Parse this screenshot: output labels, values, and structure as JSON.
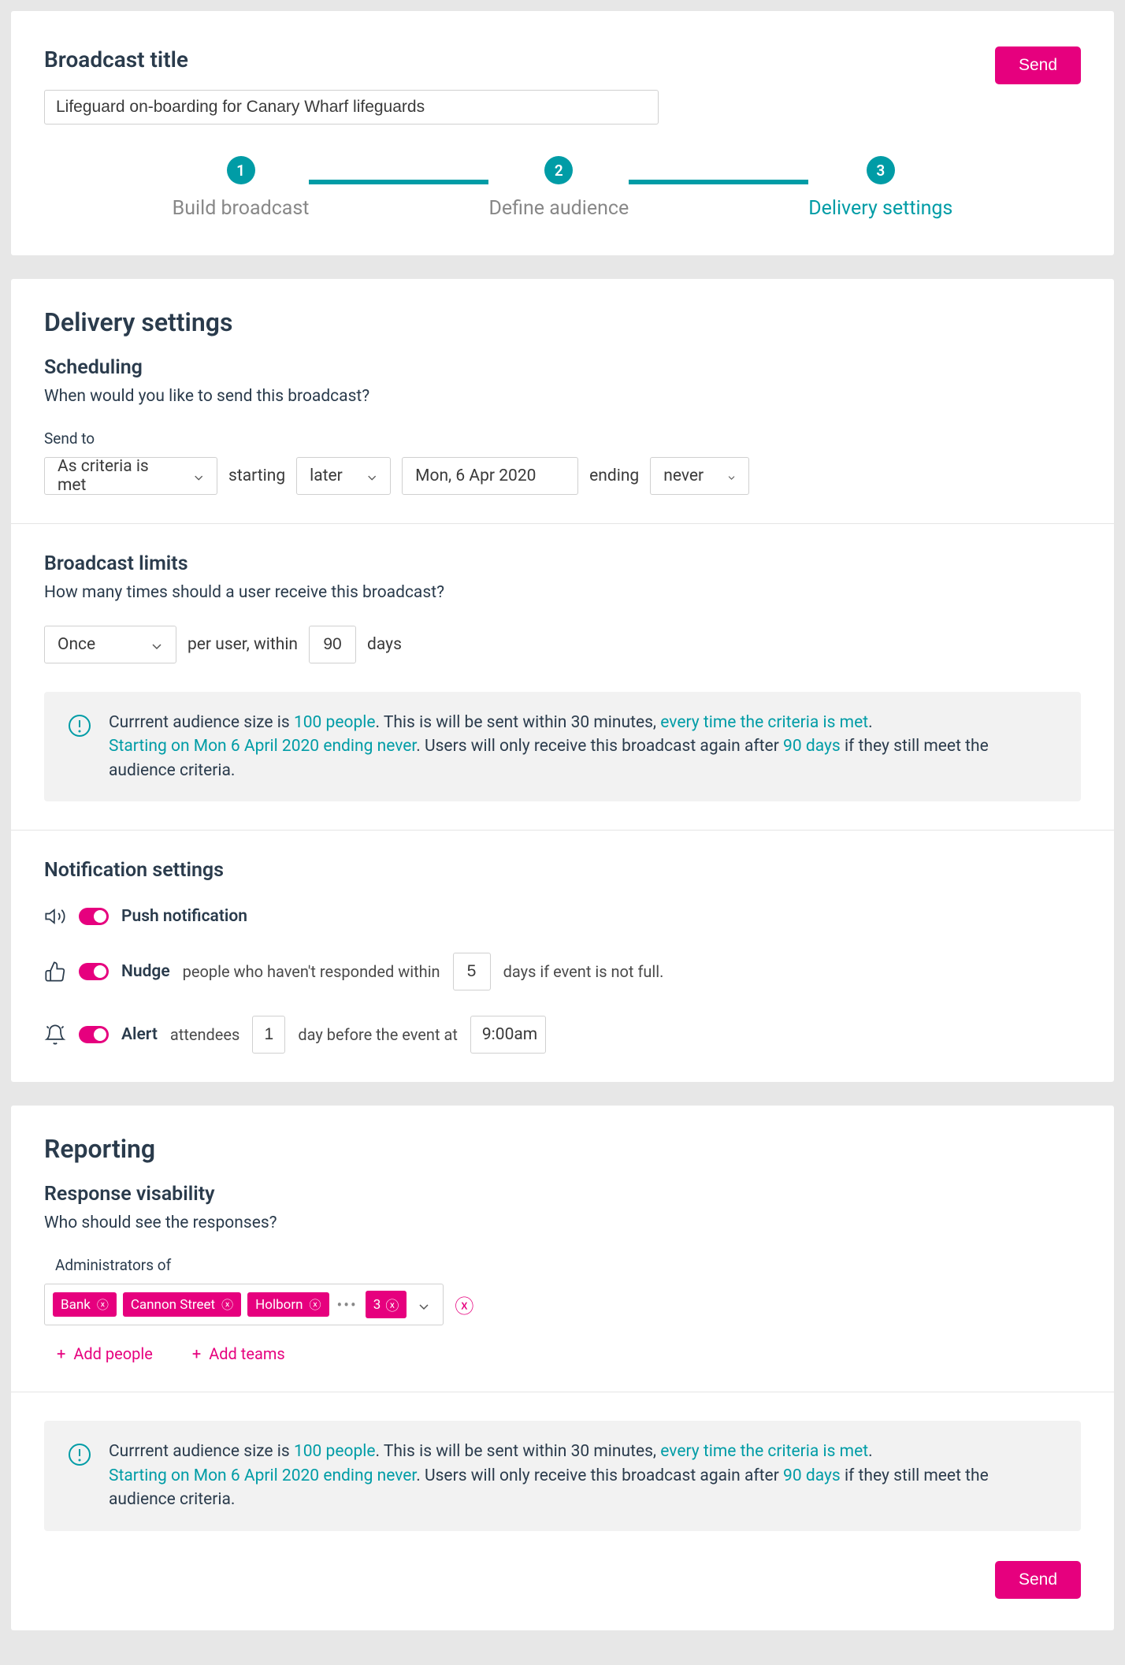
{
  "header": {
    "title_label": "Broadcast title",
    "title_value": "Lifeguard on-boarding for Canary Wharf lifeguards",
    "send_button": "Send"
  },
  "stepper": {
    "steps": [
      {
        "num": "1",
        "label": "Build broadcast"
      },
      {
        "num": "2",
        "label": "Define audience"
      },
      {
        "num": "3",
        "label": "Delivery settings"
      }
    ]
  },
  "delivery": {
    "heading": "Delivery settings",
    "scheduling": {
      "heading": "Scheduling",
      "sub": "When would you like to send this broadcast?",
      "send_to_label": "Send to",
      "criteria": "As criteria is met",
      "starting": "starting",
      "later": "later",
      "date": "Mon, 6 Apr 2020",
      "ending": "ending",
      "never": "never"
    },
    "limits": {
      "heading": "Broadcast limits",
      "sub": "How many times should a user receive this broadcast?",
      "once": "Once",
      "per_user": "per user, within",
      "days_value": "90",
      "days_label": "days"
    },
    "info": {
      "p1_a": "Currrent audience size is ",
      "p1_b": "100 people",
      "p1_c": ". This is will be sent within 30 minutes, ",
      "p1_d": "every time the criteria is met",
      "p1_e": ".",
      "p2_a": "Starting on Mon 6 April 2020 ending never",
      "p2_b": ". Users will only receive this broadcast again after ",
      "p2_c": "90 days",
      "p2_d": " if they still meet the audience criteria."
    },
    "notifications": {
      "heading": "Notification settings",
      "push": "Push notification",
      "nudge_label": "Nudge",
      "nudge_text1": "people who haven't responded within",
      "nudge_days": "5",
      "nudge_text2": "days if event is not full.",
      "alert_label": "Alert",
      "alert_text1": "attendees",
      "alert_days": "1",
      "alert_text2": "day before the event at",
      "alert_time": "9:00am"
    }
  },
  "reporting": {
    "heading": "Reporting",
    "visibility": {
      "heading": "Response visability",
      "sub": "Who should see the responses?",
      "admin_label": "Administrators of",
      "chips": [
        "Bank",
        "Cannon Street",
        "Holborn"
      ],
      "more_count": "3",
      "add_people": "Add people",
      "add_teams": "Add teams"
    },
    "footer_send": "Send"
  }
}
